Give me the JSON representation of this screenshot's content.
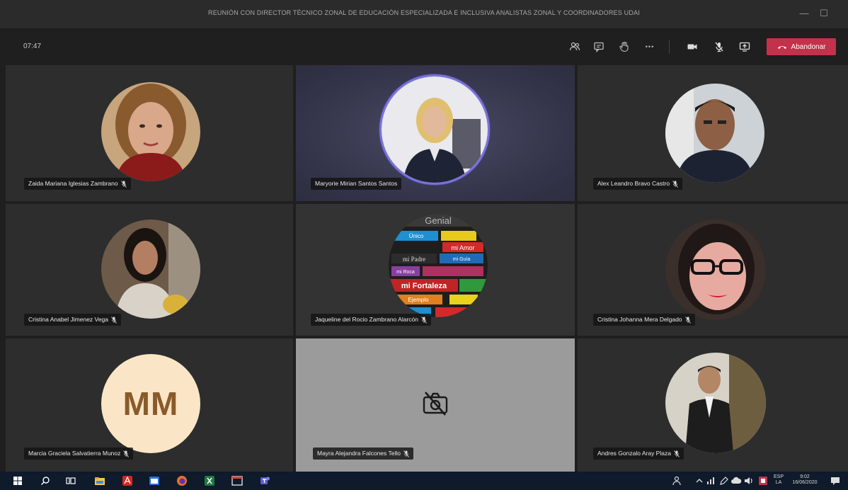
{
  "window": {
    "title": "REUNIÓN CON DIRECTOR TÉCNICO ZONAL DE EDUCACIÓN ESPECIALIZADA E INCLUSIVA ANALISTAS ZONAL Y COORDINADORES UDAI",
    "minimize_glyph": "—",
    "maximize_glyph": "☐"
  },
  "toolbar": {
    "timer": "07:47",
    "leave_label": "Abandonar",
    "more_glyph": "•••"
  },
  "participants": [
    {
      "name": "Zaida Mariana Iglesias Zambrano",
      "muted": true,
      "type": "photo"
    },
    {
      "name": "Maryorie Mirian Santos Santos",
      "muted": false,
      "type": "photo",
      "speaking": true
    },
    {
      "name": "Alex Leandro Bravo Castro",
      "muted": true,
      "type": "photo"
    },
    {
      "name": "Cristina Anabel Jimenez Vega",
      "muted": true,
      "type": "photo"
    },
    {
      "name": "Jaqueline del Rocio Zambrano Alarcón",
      "muted": true,
      "type": "photo"
    },
    {
      "name": "Cristina Johanna Mera Delgado",
      "muted": true,
      "type": "photo"
    },
    {
      "name": "Marcia Graciela Salvatierra Munoz",
      "muted": true,
      "type": "initials",
      "initials": "MM"
    },
    {
      "name": "Mayra Alejandra Falcones Tello",
      "muted": true,
      "type": "camera-off"
    },
    {
      "name": "Andres Gonzalo Aray Plaza",
      "muted": true,
      "type": "photo"
    }
  ],
  "collage_words": [
    "Genial",
    "Único",
    "mi Amor",
    "mi Padre",
    "mi Guía",
    "mi Roca",
    "mi Fortaleza",
    "Ejemplo"
  ],
  "taskbar": {
    "lang_top": "ESP",
    "lang_bottom": "LA",
    "time": "9:02",
    "date": "16/06/2020"
  },
  "colors": {
    "leave": "#c4314b",
    "speaking_ring": "#7a73d8",
    "initials_bg": "#fae6c6",
    "initials_fg": "#8a5a2b"
  }
}
